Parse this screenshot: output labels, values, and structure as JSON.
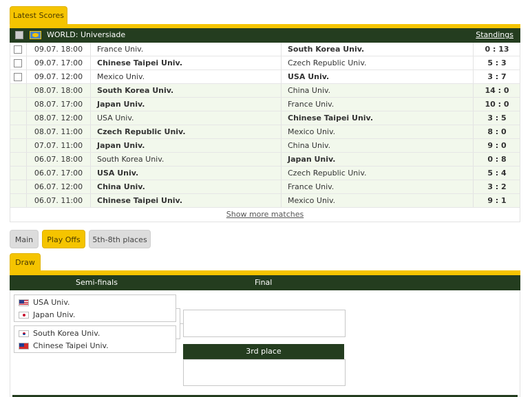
{
  "tabs": {
    "latest_scores": "Latest Scores"
  },
  "league": {
    "name": "WORLD: Universiade",
    "standings_link": "Standings"
  },
  "matches": [
    {
      "time": "09.07. 18:00",
      "home": "France Univ.",
      "away": "South Korea Univ.",
      "score": "0 : 13",
      "winner": "away",
      "checkbox": true
    },
    {
      "time": "09.07. 17:00",
      "home": "Chinese Taipei Univ.",
      "away": "Czech Republic Univ.",
      "score": "5 : 3",
      "winner": "home",
      "checkbox": true
    },
    {
      "time": "09.07. 12:00",
      "home": "Mexico Univ.",
      "away": "USA Univ.",
      "score": "3 : 7",
      "winner": "away",
      "checkbox": true
    },
    {
      "time": "08.07. 18:00",
      "home": "South Korea Univ.",
      "away": "China Univ.",
      "score": "14 : 0",
      "winner": "home",
      "checkbox": false
    },
    {
      "time": "08.07. 17:00",
      "home": "Japan Univ.",
      "away": "France Univ.",
      "score": "10 : 0",
      "winner": "home",
      "checkbox": false
    },
    {
      "time": "08.07. 12:00",
      "home": "USA Univ.",
      "away": "Chinese Taipei Univ.",
      "score": "3 : 5",
      "winner": "away",
      "checkbox": false
    },
    {
      "time": "08.07. 11:00",
      "home": "Czech Republic Univ.",
      "away": "Mexico Univ.",
      "score": "8 : 0",
      "winner": "home",
      "checkbox": false
    },
    {
      "time": "07.07. 11:00",
      "home": "Japan Univ.",
      "away": "China Univ.",
      "score": "9 : 0",
      "winner": "home",
      "checkbox": false
    },
    {
      "time": "06.07. 18:00",
      "home": "South Korea Univ.",
      "away": "Japan Univ.",
      "score": "0 : 8",
      "winner": "away",
      "checkbox": false
    },
    {
      "time": "06.07. 17:00",
      "home": "USA Univ.",
      "away": "Czech Republic Univ.",
      "score": "5 : 4",
      "winner": "home",
      "checkbox": false
    },
    {
      "time": "06.07. 12:00",
      "home": "China Univ.",
      "away": "France Univ.",
      "score": "3 : 2",
      "winner": "home",
      "checkbox": false
    },
    {
      "time": "06.07. 11:00",
      "home": "Chinese Taipei Univ.",
      "away": "Mexico Univ.",
      "score": "9 : 1",
      "winner": "home",
      "checkbox": false
    }
  ],
  "show_more": "Show more matches",
  "subtabs": {
    "main": "Main",
    "playoffs": "Play Offs",
    "places_5_8": "5th-8th places"
  },
  "draw": {
    "tab": "Draw",
    "semi_label": "Semi-finals",
    "final_label": "Final",
    "third_place": "3rd place",
    "semi1": {
      "team1": "USA Univ.",
      "team2": "Japan Univ."
    },
    "semi2": {
      "team1": "South Korea Univ.",
      "team2": "Chinese Taipei Univ."
    }
  }
}
